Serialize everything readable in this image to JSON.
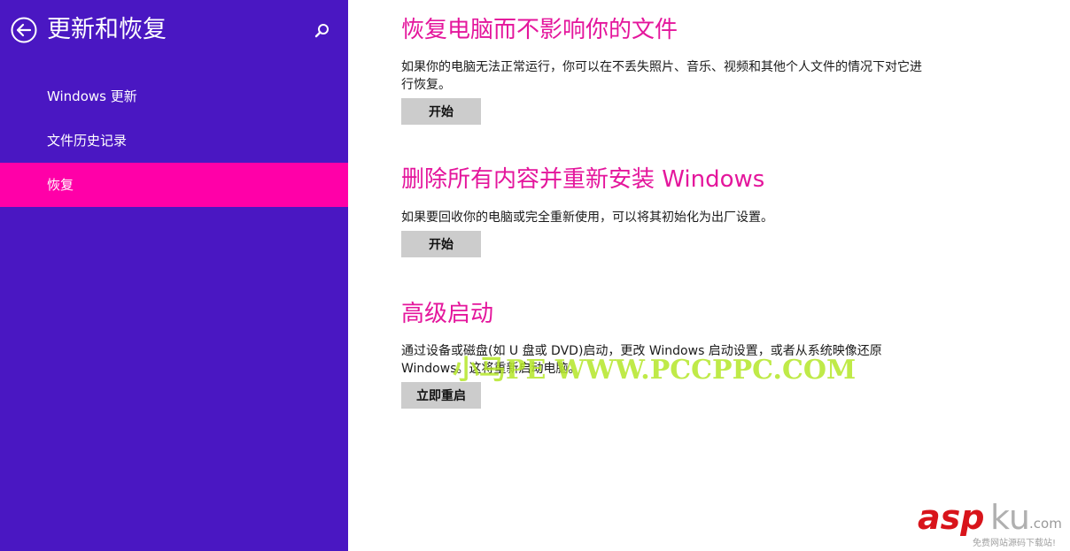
{
  "sidebar": {
    "title": "更新和恢复",
    "back_icon": "back-arrow-circle-icon",
    "search_icon": "search-icon",
    "items": [
      {
        "label": "Windows 更新",
        "active": false
      },
      {
        "label": "文件历史记录",
        "active": false
      },
      {
        "label": "恢复",
        "active": true
      }
    ]
  },
  "sections": [
    {
      "title": "恢复电脑而不影响你的文件",
      "description": "如果你的电脑无法正常运行，你可以在不丢失照片、音乐、视频和其他个人文件的情况下对它进行恢复。",
      "button": "开始"
    },
    {
      "title": "删除所有内容并重新安装 Windows",
      "description": "如果要回收你的电脑或完全重新使用，可以将其初始化为出厂设置。",
      "button": "开始"
    },
    {
      "title": "高级启动",
      "description": "通过设备或磁盘(如 U 盘或 DVD)启动，更改 Windows 启动设置，或者从系统映像还原 Windows。这将重新启动电脑。",
      "button": "立即重启"
    }
  ],
  "watermarks": {
    "green": "小马PE WWW.PCCPPC.COM",
    "asp": "asp",
    "ku": "ku",
    "com": ".com",
    "sub": "免费网站源码下载站!"
  },
  "colors": {
    "sidebar_bg": "#4a17c2",
    "active_item_bg": "#ff00a8",
    "heading": "#e4169c",
    "button_bg": "#cccccc"
  }
}
